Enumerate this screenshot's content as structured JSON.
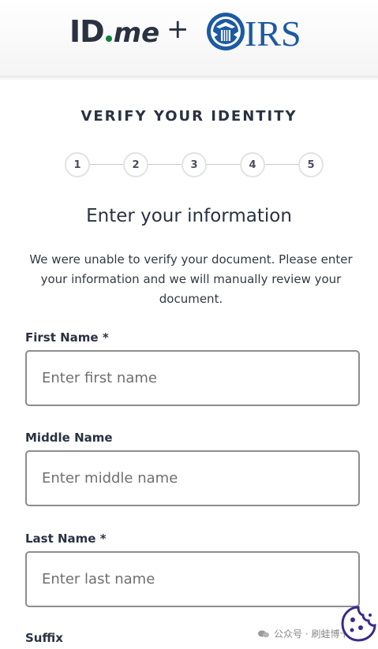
{
  "header": {
    "idme_logo": {
      "id_text": "ID",
      "me_text": "me"
    },
    "plus": "+",
    "irs_logo": {
      "text": "IRS",
      "seal_icon": "eagle-seal-icon"
    }
  },
  "title": "VERIFY YOUR IDENTITY",
  "steps": [
    "1",
    "2",
    "3",
    "4",
    "5"
  ],
  "form": {
    "heading": "Enter your information",
    "description": "We were unable to verify your document. Please enter your information and we will manually review your document.",
    "fields": {
      "first_name": {
        "label": "First Name",
        "required_mark": "*",
        "placeholder": "Enter first name",
        "value": ""
      },
      "middle_name": {
        "label": "Middle Name",
        "placeholder": "Enter middle name",
        "value": ""
      },
      "last_name": {
        "label": "Last Name",
        "required_mark": "*",
        "placeholder": "Enter last name",
        "value": ""
      },
      "suffix": {
        "label": "Suffix"
      }
    }
  },
  "watermark": {
    "text": "公众号 · 刷蛙博卡",
    "icon": "wechat-icon"
  },
  "overlay_icon": "cookie-icon",
  "colors": {
    "brand_green": "#08833d",
    "irs_blue": "#1c5aa3",
    "text": "#2a3242"
  }
}
